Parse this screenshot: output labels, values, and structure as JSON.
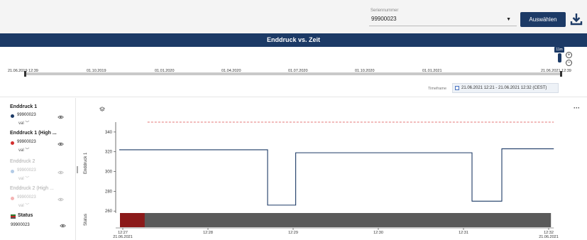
{
  "header": {
    "serial_label": "Seriennummer",
    "serial_value": "99900023",
    "select_button": "Auswählen",
    "download_icon": "download-icon"
  },
  "chart_title": "Enddruck vs. Zeit",
  "navigator": {
    "ticks": [
      "21.06.2019 12:39",
      "01.10.2019",
      "01.01.2020",
      "01.04.2020",
      "01.07.2020",
      "01.10.2020",
      "01.01.2021",
      "21.06.2021 12:39"
    ],
    "badge": "11m",
    "zoom_in": "+",
    "zoom_out": "−"
  },
  "timeframe": {
    "label": "Timeframe",
    "value": "21.06.2021 12:21 - 21.06.2021 12:32 (CEST)"
  },
  "legend": [
    {
      "title": "Enddruck 1",
      "serial": "99900023",
      "val": "val",
      "color": "#1c3a66",
      "active": true
    },
    {
      "title": "Enddruck 1 (High ...",
      "serial": "99900023",
      "val": "val",
      "color": "#d32f2f",
      "active": true
    },
    {
      "title": "Enddruck 2",
      "serial": "99900023",
      "val": "val",
      "color": "#b3cbe6",
      "active": false
    },
    {
      "title": "Enddruck 2 (High ...",
      "serial": "99900023",
      "val": "val",
      "color": "#f4b3b3",
      "active": false
    }
  ],
  "status_legend": {
    "title": "Status",
    "serial": "99900023"
  },
  "chart_data": {
    "type": "line",
    "ylabel": "Enddruck 1",
    "status_label": "Status",
    "y_ticks": [
      260,
      280,
      300,
      320,
      340
    ],
    "ylim": [
      258,
      350
    ],
    "x_ticks": [
      {
        "label": "12:27",
        "sub": "21.06.2021"
      },
      {
        "label": "12:28",
        "sub": ""
      },
      {
        "label": "12:29",
        "sub": ""
      },
      {
        "label": "12:30",
        "sub": ""
      },
      {
        "label": "12:31",
        "sub": ""
      },
      {
        "label": "12:32",
        "sub": "21.06.2021"
      }
    ],
    "x_range_min": [
      0,
      5
    ],
    "series": [
      {
        "name": "Enddruck 1",
        "color": "#1c3a66",
        "points": [
          [
            0,
            322
          ],
          [
            1.7,
            322
          ],
          [
            1.7,
            266
          ],
          [
            2.03,
            266
          ],
          [
            2.03,
            319
          ],
          [
            4.1,
            319
          ],
          [
            4.1,
            270
          ],
          [
            4.45,
            270
          ],
          [
            4.45,
            323
          ],
          [
            5.06,
            323
          ]
        ]
      },
      {
        "name": "Enddruck 1 (High ...",
        "color": "#e57373",
        "dashed": true,
        "points": [
          [
            0.29,
            350
          ],
          [
            5.06,
            350
          ]
        ]
      }
    ],
    "status_segments": [
      {
        "from": 0,
        "to": 0.29,
        "color": "#8b1a1a"
      },
      {
        "from": 0.29,
        "to": 5.06,
        "color": "#5a5a5a"
      }
    ]
  }
}
